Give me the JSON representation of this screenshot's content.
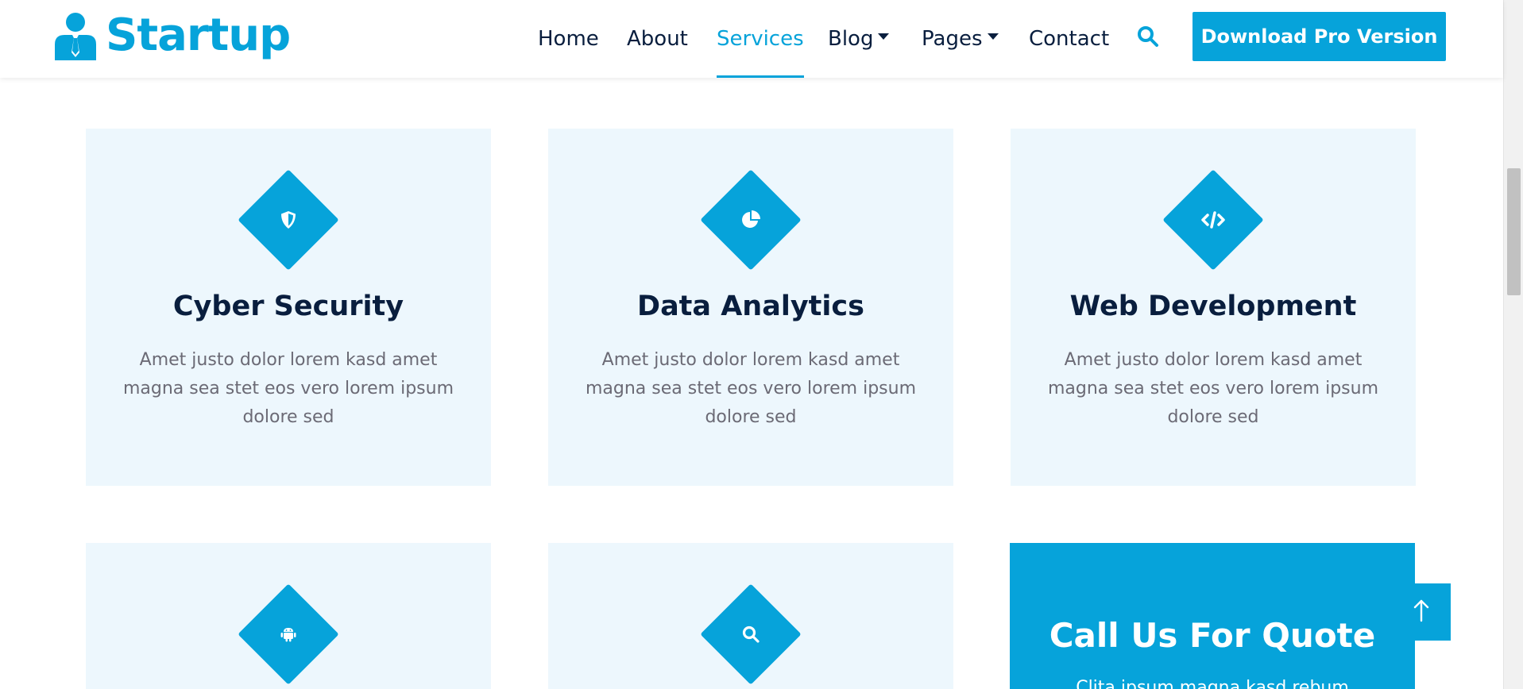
{
  "brand": {
    "name": "Startup",
    "color": "#06A3DA"
  },
  "nav": {
    "items": [
      {
        "label": "Home",
        "active": false,
        "dropdown": false
      },
      {
        "label": "About",
        "active": false,
        "dropdown": false
      },
      {
        "label": "Services",
        "active": true,
        "dropdown": false
      },
      {
        "label": "Blog",
        "active": false,
        "dropdown": true
      },
      {
        "label": "Pages",
        "active": false,
        "dropdown": true
      },
      {
        "label": "Contact",
        "active": false,
        "dropdown": false
      }
    ],
    "search_icon": "search-icon",
    "cta_label": "Download Pro Version"
  },
  "services": [
    {
      "title": "Cyber Security",
      "icon": "shield-icon",
      "text": "Amet justo dolor lorem kasd amet magna sea stet eos vero lorem ipsum dolore sed"
    },
    {
      "title": "Data Analytics",
      "icon": "pie-chart-icon",
      "text": "Amet justo dolor lorem kasd amet magna sea stet eos vero lorem ipsum dolore sed"
    },
    {
      "title": "Web Development",
      "icon": "code-icon",
      "text": "Amet justo dolor lorem kasd amet magna sea stet eos vero lorem ipsum dolore sed"
    },
    {
      "title": "",
      "icon": "android-icon",
      "text": ""
    },
    {
      "title": "",
      "icon": "search-icon",
      "text": ""
    }
  ],
  "quote": {
    "title": "Call Us For Quote",
    "text": "Clita ipsum magna kasd rebum"
  },
  "colors": {
    "primary": "#06A3DA",
    "dark": "#091E3E",
    "light": "#EDF7FD",
    "muted": "#6B6A75"
  }
}
